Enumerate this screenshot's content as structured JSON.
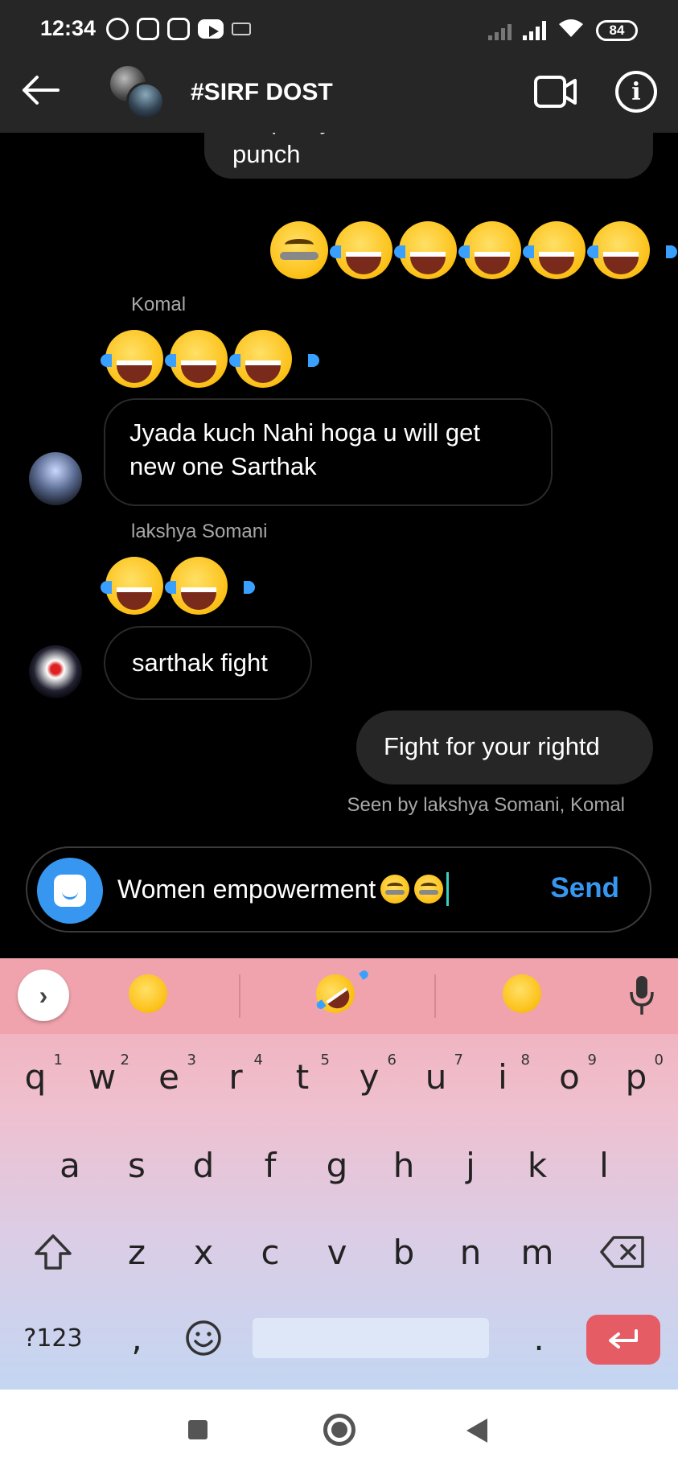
{
  "status_bar": {
    "time": "12:34",
    "battery": "84",
    "left_icons": [
      "alarm-icon",
      "instagram-icon",
      "instagram-icon",
      "youtube-icon",
      "keyboard-icon"
    ],
    "right_icons": [
      "signal-no-service-icon",
      "signal-icon",
      "wifi-icon",
      "battery-icon"
    ]
  },
  "header": {
    "title": "#SIRF DOST",
    "back_icon": "arrow-left-icon",
    "video_icon": "video-call-icon",
    "info_icon": "info-icon"
  },
  "messages": {
    "partial_top": "U open your tabs screen and hit punch",
    "emoji_row_mine": [
      "zipper-mouth-face",
      "face-with-tears-of-joy",
      "face-with-tears-of-joy",
      "face-with-tears-of-joy",
      "face-with-tears-of-joy",
      "face-with-tears-of-joy"
    ],
    "komal_name": "Komal",
    "komal_emojis": [
      "face-with-tears-of-joy",
      "face-with-tears-of-joy",
      "face-with-tears-of-joy"
    ],
    "komal_text_line1": "Jyada kuch Nahi hoga u will get",
    "komal_text_line2": "new one Sarthak",
    "lakshya_name": "lakshya Somani",
    "lakshya_emojis": [
      "face-with-tears-of-joy",
      "face-with-tears-of-joy"
    ],
    "lakshya_text": "sarthak fight",
    "my_last": "Fight for your rightd",
    "seen_by": "Seen by lakshya Somani, Komal"
  },
  "composer": {
    "text": "Women empowerment ",
    "trailing_emojis": [
      "zipper-mouth-face",
      "zipper-mouth-face"
    ],
    "send_label": "Send",
    "accent": "#3797f0"
  },
  "keyboard": {
    "suggestions": [
      "unamused-face",
      "rolling-on-the-floor-laughing",
      "zany-face"
    ],
    "row1": [
      {
        "k": "q",
        "n": "1"
      },
      {
        "k": "w",
        "n": "2"
      },
      {
        "k": "e",
        "n": "3"
      },
      {
        "k": "r",
        "n": "4"
      },
      {
        "k": "t",
        "n": "5"
      },
      {
        "k": "y",
        "n": "6"
      },
      {
        "k": "u",
        "n": "7"
      },
      {
        "k": "i",
        "n": "8"
      },
      {
        "k": "o",
        "n": "9"
      },
      {
        "k": "p",
        "n": "0"
      }
    ],
    "row2": [
      "a",
      "s",
      "d",
      "f",
      "g",
      "h",
      "j",
      "k",
      "l"
    ],
    "row3": [
      "z",
      "x",
      "c",
      "v",
      "b",
      "n",
      "m"
    ],
    "symbols_label": "?123",
    "comma": ",",
    "period": ".",
    "enter_color": "#e55c65"
  },
  "nav_bar": {
    "icons": [
      "recents-square-icon",
      "home-circle-icon",
      "back-triangle-icon"
    ]
  }
}
